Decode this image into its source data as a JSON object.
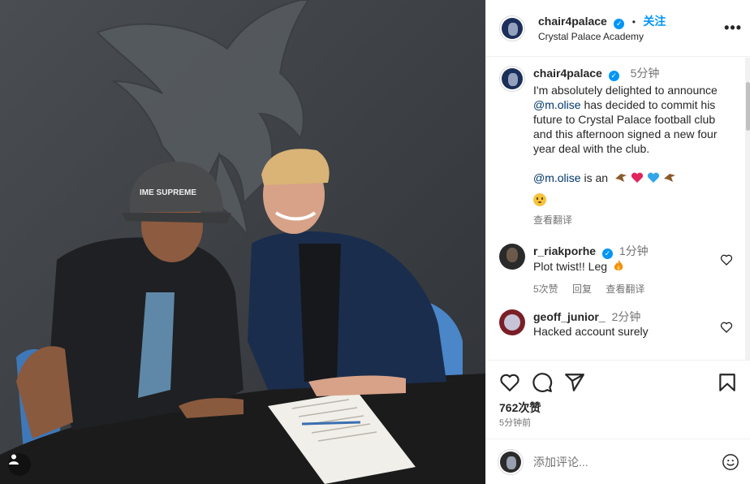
{
  "post": {
    "author": "chair4palace",
    "follow_label": "关注",
    "location": "Crystal Palace Academy",
    "more_label": "•••"
  },
  "caption": {
    "author": "chair4palace",
    "time": "5分钟",
    "text_pre": "I'm absolutely delighted to announce ",
    "mention1": "@m.olise",
    "text_post": " has decided to commit his future to Crystal Palace football club and this afternoon signed a new four year deal with the club.",
    "mention2": "@m.olise",
    "is_an": " is an",
    "see_translation": "查看翻译"
  },
  "comments": [
    {
      "user": "r_riakporhe",
      "time": "1分钟",
      "text": "Plot twist!! Leg",
      "likes": "5次赞",
      "reply": "回复",
      "see_translation": "查看翻译"
    },
    {
      "user": "geoff_junior_",
      "time": "2分钟",
      "text": "Hacked account surely"
    }
  ],
  "footer": {
    "likes": "762次赞",
    "posted": "5分钟前",
    "comment_placeholder": "添加评论..."
  },
  "colors": {
    "link_blue": "#0095f6",
    "verified": "#0095f6",
    "muted": "#737373"
  },
  "icons": [
    "heart-icon",
    "comment-icon",
    "share-icon",
    "bookmark-icon",
    "emoji-icon",
    "verified-icon",
    "more-icon",
    "user-tag-icon"
  ]
}
